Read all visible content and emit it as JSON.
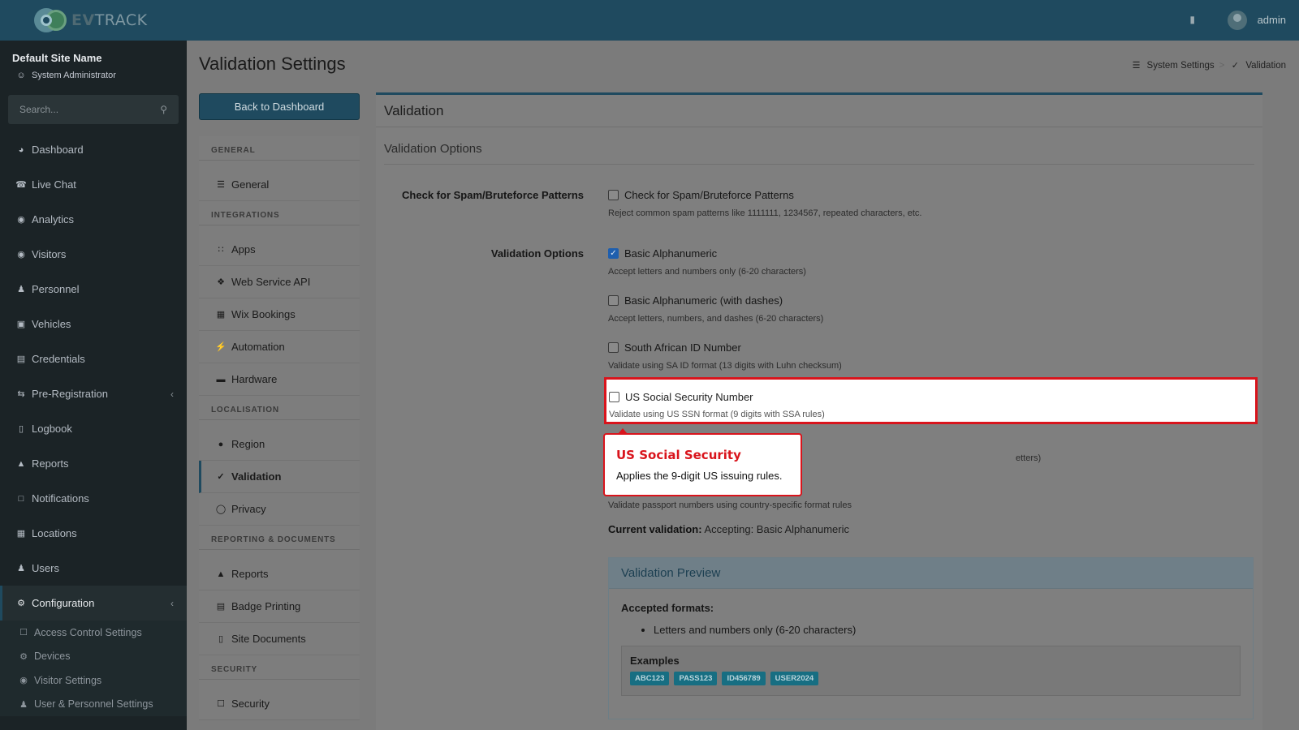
{
  "app": {
    "logo_prefix": "EV",
    "logo_suffix": "TRACK"
  },
  "topbar": {
    "user": "admin"
  },
  "sidebar": {
    "site_name": "Default Site Name",
    "role": "System Administrator",
    "search_placeholder": "Search...",
    "items": [
      {
        "label": "Dashboard",
        "icon": "gauge-icon"
      },
      {
        "label": "Live Chat",
        "icon": "headset-icon"
      },
      {
        "label": "Analytics",
        "icon": "target-icon"
      },
      {
        "label": "Visitors",
        "icon": "eye-icon"
      },
      {
        "label": "Personnel",
        "icon": "user-tie-icon"
      },
      {
        "label": "Vehicles",
        "icon": "car-icon"
      },
      {
        "label": "Credentials",
        "icon": "id-card-icon"
      },
      {
        "label": "Pre-Registration",
        "icon": "exchange-icon"
      },
      {
        "label": "Logbook",
        "icon": "book-icon"
      },
      {
        "label": "Reports",
        "icon": "chart-icon"
      },
      {
        "label": "Notifications",
        "icon": "comment-icon"
      },
      {
        "label": "Locations",
        "icon": "building-icon"
      },
      {
        "label": "Users",
        "icon": "users-icon"
      },
      {
        "label": "Configuration",
        "icon": "gear-icon"
      }
    ],
    "subitems": [
      {
        "label": "Access Control Settings"
      },
      {
        "label": "Devices"
      },
      {
        "label": "Visitor Settings"
      },
      {
        "label": "User & Personnel Settings"
      }
    ]
  },
  "page": {
    "title": "Validation Settings",
    "breadcrumb": [
      "System Settings",
      ">",
      "Validation"
    ],
    "back_button": "Back to Dashboard"
  },
  "settings_menu": {
    "general_header": "GENERAL",
    "general": [
      "General"
    ],
    "integrations_header": "INTEGRATIONS",
    "integrations": [
      "Apps",
      "Web Service API",
      "Wix Bookings",
      "Automation",
      "Hardware"
    ],
    "localisation_header": "LOCALISATION",
    "localisation": [
      "Region",
      "Validation",
      "Privacy"
    ],
    "reporting_header": "REPORTING & DOCUMENTS",
    "reporting": [
      "Reports",
      "Badge Printing",
      "Site Documents"
    ],
    "security_header": "SECURITY",
    "security": [
      "Security"
    ]
  },
  "panel": {
    "title": "Validation",
    "subtitle": "Validation Options",
    "spam_label": "Check for Spam/Bruteforce Patterns",
    "spam_option": "Check for Spam/Bruteforce Patterns",
    "spam_help": "Reject common spam patterns like 1111111, 1234567, repeated characters, etc.",
    "options_label": "Validation Options",
    "options": [
      {
        "label": "Basic Alphanumeric",
        "help": "Accept letters and numbers only (6-20 characters)",
        "checked": true
      },
      {
        "label": "Basic Alphanumeric (with dashes)",
        "help": "Accept letters, numbers, and dashes (6-20 characters)",
        "checked": false
      },
      {
        "label": "South African ID Number",
        "help": "Validate using SA ID format (13 digits with Luhn checksum)",
        "checked": false
      },
      {
        "label": "US Social Security Number",
        "help": "Validate using US SSN format (9 digits with SSA rules)",
        "checked": false
      }
    ],
    "hidden_help_fragment": "etters)",
    "passport_help": "Validate passport numbers using country-specific format rules",
    "current_label": "Current validation:",
    "current_value": "Accepting: Basic Alphanumeric"
  },
  "tooltip": {
    "title": "US Social Security",
    "body": "Applies the 9-digit US issuing rules."
  },
  "preview": {
    "title": "Validation Preview",
    "accepted_label": "Accepted formats:",
    "accepted": [
      "Letters and numbers only (6-20 characters)"
    ],
    "examples_title": "Examples",
    "examples": [
      "ABC123",
      "PASS123",
      "ID456789",
      "USER2024"
    ]
  },
  "colors": {
    "brand": "#1f4a5f",
    "highlight": "#d9141c",
    "check": "#1f5fae",
    "badge": "#176e82"
  }
}
